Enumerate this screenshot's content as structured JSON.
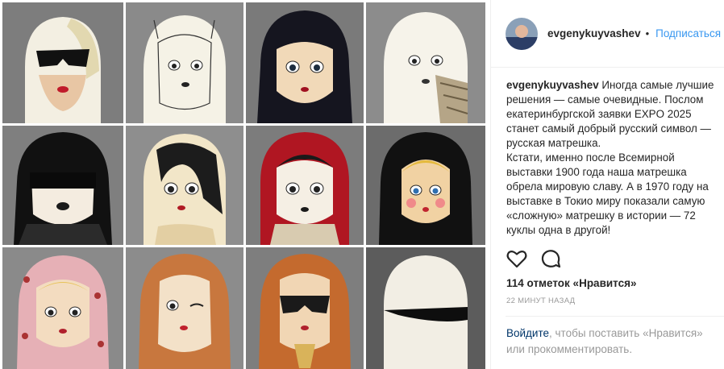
{
  "post": {
    "username": "evgenykuyvashev",
    "dot": "•",
    "follow_label": "Подписаться",
    "caption_username": "evgenykuyvashev",
    "caption_p1": "Иногда самые лучшие решения — самые очевидные. Послом екатеринбургской заявки EXPO 2025 станет самый добрый русский символ — русская матрешка.",
    "caption_p2": "Кстати, именно после Всемирной выставки 1900 года наша матрешка обрела мировую славу. А в 1970 году на выставке в Токио миру показали самую «сложную» матрешку в истории — 72 куклы одна в другой!",
    "likes": "114 отметок «Нравится»",
    "time_ago": "22 МИНУТ НАЗАД",
    "login_link": "Войдите",
    "login_text": ", чтобы поставить «Нравится» или прокомментировать."
  },
  "icons": {
    "like": "heart-icon",
    "comment": "comment-icon"
  },
  "colors": {
    "link_blue": "#3897f0",
    "text": "#262626",
    "muted": "#999999",
    "login_link": "#003569"
  }
}
